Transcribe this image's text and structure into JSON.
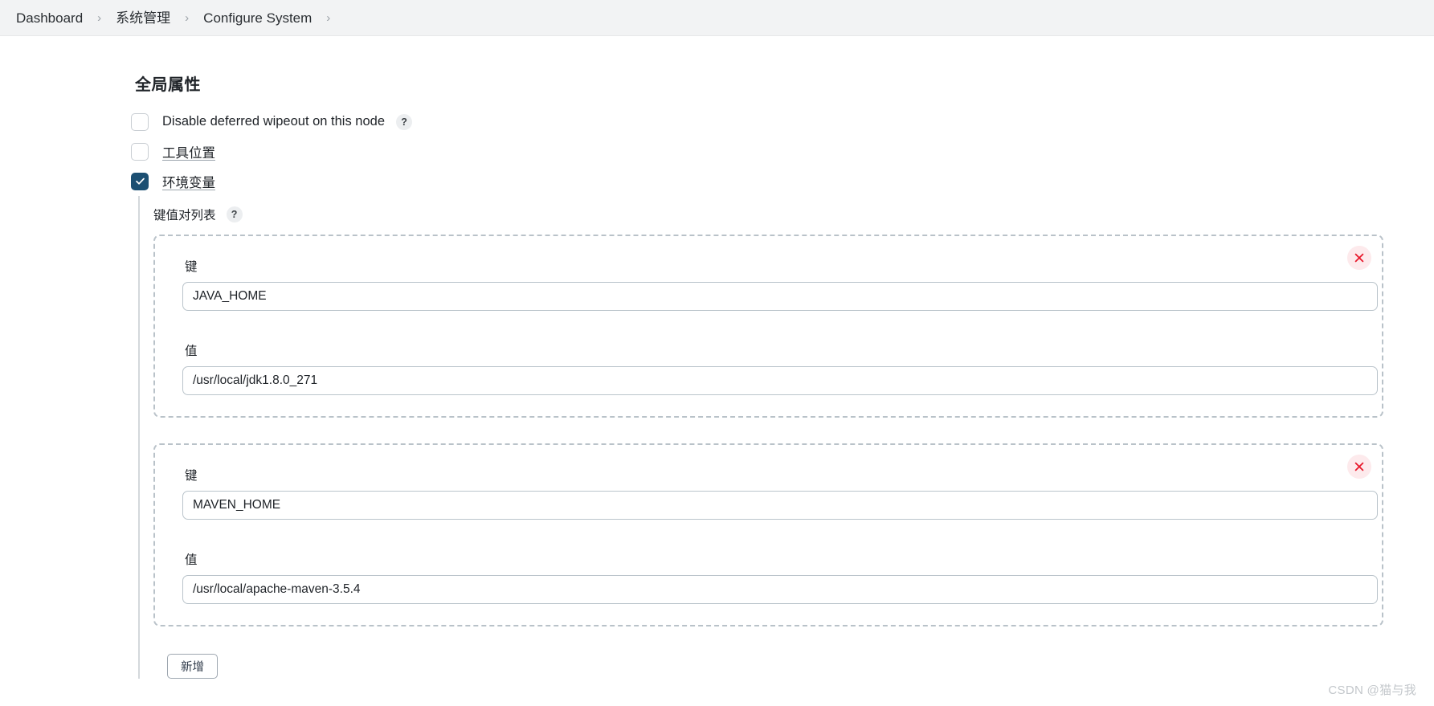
{
  "breadcrumb": {
    "separator": "›",
    "items": [
      {
        "label": "Dashboard"
      },
      {
        "label": "系统管理"
      },
      {
        "label": "Configure System"
      }
    ],
    "trailing_separator": "›"
  },
  "page": {
    "title": "全局属性"
  },
  "checkboxes": [
    {
      "label": "Disable deferred wipeout on this node",
      "checked": false,
      "underlined": false,
      "has_help": true,
      "help_glyph": "?"
    },
    {
      "label": "工具位置",
      "checked": false,
      "underlined": true,
      "has_help": false,
      "help_glyph": "?"
    },
    {
      "label": "环境变量",
      "checked": true,
      "underlined": true,
      "has_help": false,
      "help_glyph": "?"
    }
  ],
  "env_section": {
    "list_label": "键值对列表",
    "list_help_glyph": "?",
    "key_label": "键",
    "value_label": "值",
    "delete_glyph": "×",
    "add_button_label": "新增",
    "entries": [
      {
        "key_label": "键",
        "key_value": "JAVA_HOME",
        "value_label": "值",
        "value_value": "/usr/local/jdk1.8.0_271"
      },
      {
        "key_label": "键",
        "key_value": "MAVEN_HOME",
        "value_label": "值",
        "value_value": "/usr/local/apache-maven-3.5.4"
      }
    ]
  },
  "watermark": {
    "text": "CSDN @猫与我"
  },
  "colors": {
    "breadcrumb_bg": "#f2f3f4",
    "checkbox_checked": "#1c4f72",
    "delete_bg": "#fdeaec",
    "delete_mark": "#e8192c",
    "dashed_border": "#b9c2c9",
    "input_border": "#bac4cb"
  }
}
